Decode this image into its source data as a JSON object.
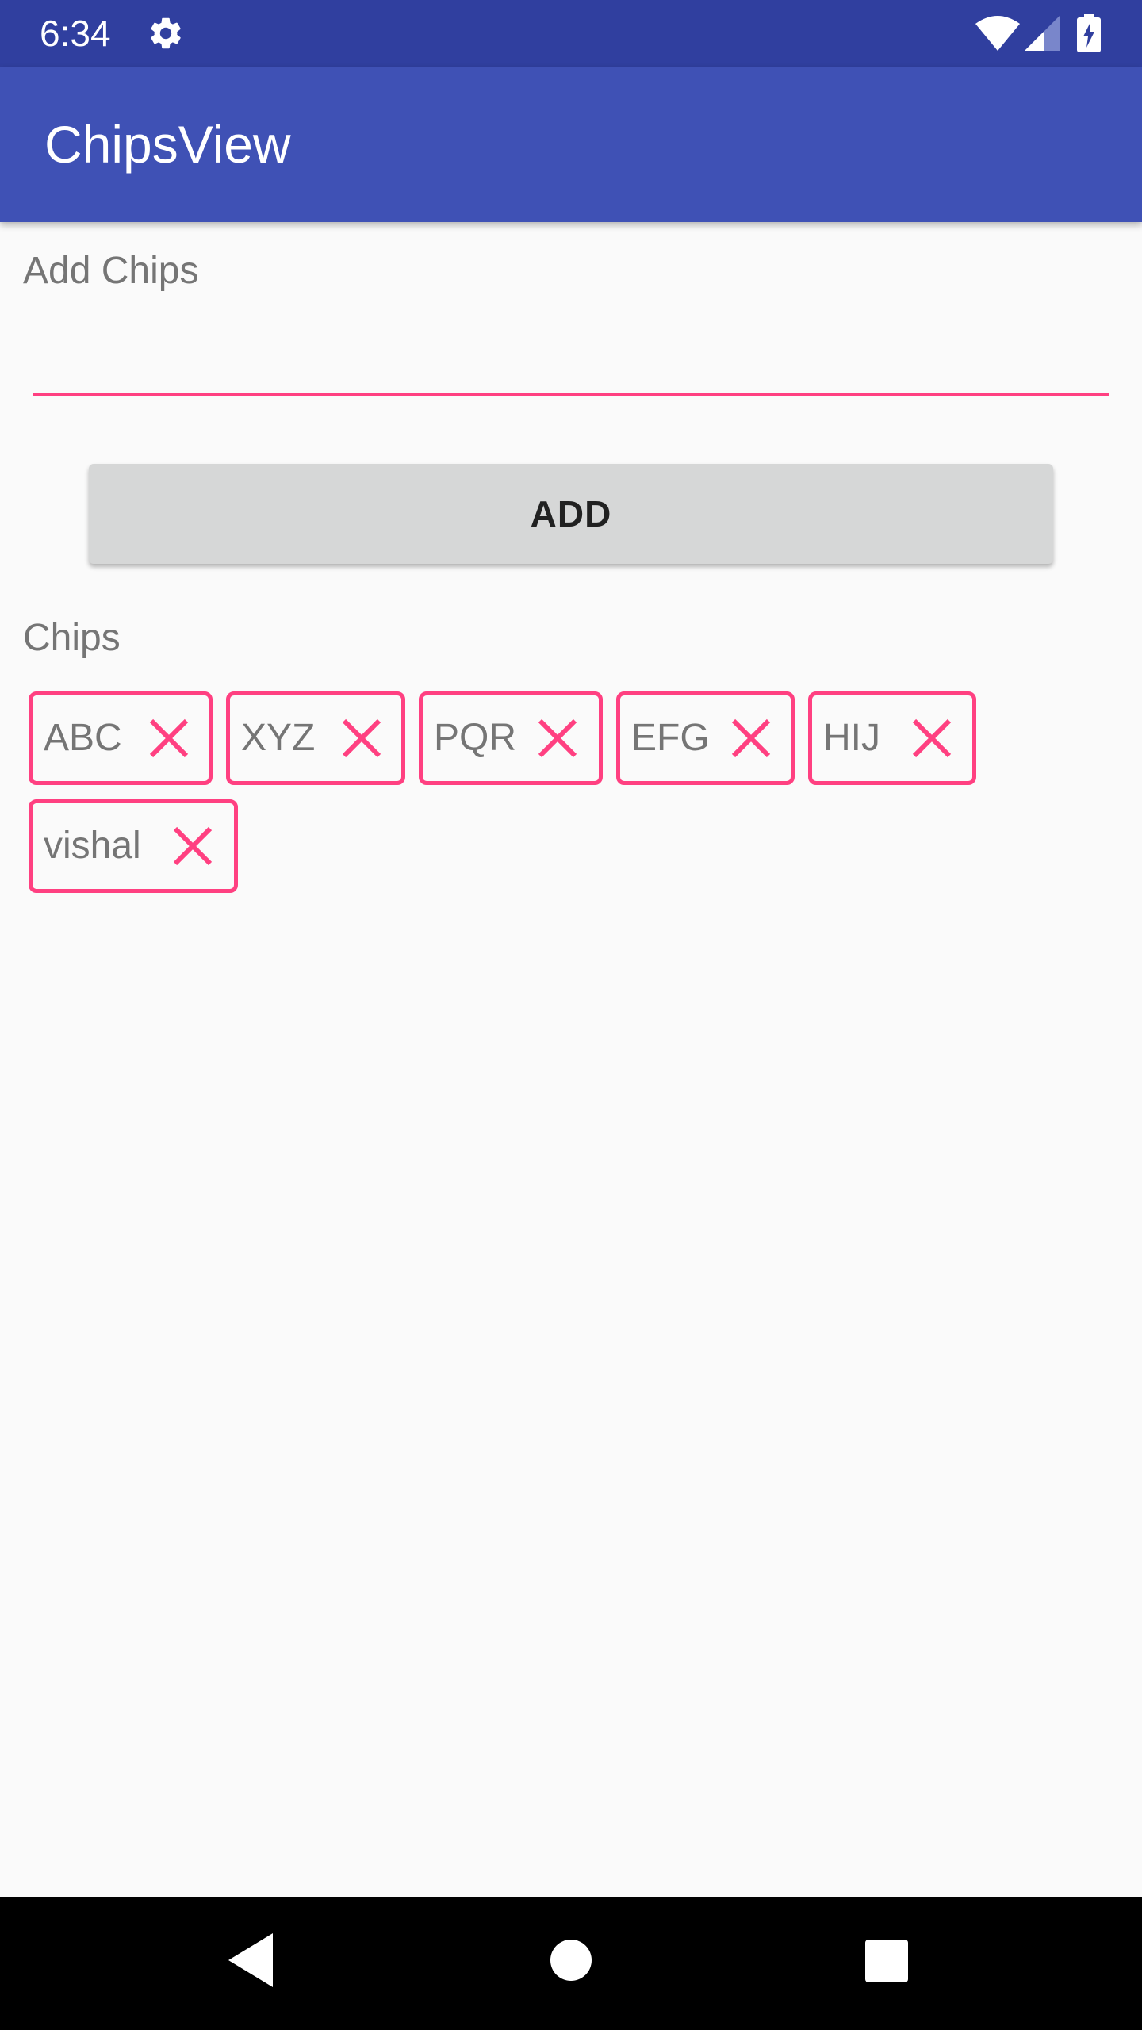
{
  "status_bar": {
    "time": "6:34",
    "icons": [
      "gear-icon",
      "wifi-icon",
      "cell-signal-icon",
      "battery-charging-icon"
    ]
  },
  "app_bar": {
    "title": "ChipsView",
    "color": "#3f51b5"
  },
  "form": {
    "add_label": "Add Chips",
    "input_value": "",
    "input_placeholder": "",
    "add_button_label": "ADD"
  },
  "chips_section": {
    "label": "Chips",
    "chips": [
      {
        "label": "ABC"
      },
      {
        "label": "XYZ"
      },
      {
        "label": "PQR"
      },
      {
        "label": "EFG"
      },
      {
        "label": "HIJ"
      },
      {
        "label": "vishal"
      }
    ]
  },
  "colors": {
    "accent": "#ff4081",
    "primary": "#3f51b5",
    "primary_dark": "#303f9f"
  },
  "nav_bar": {
    "icons": [
      "back-icon",
      "home-icon",
      "recents-icon"
    ]
  }
}
